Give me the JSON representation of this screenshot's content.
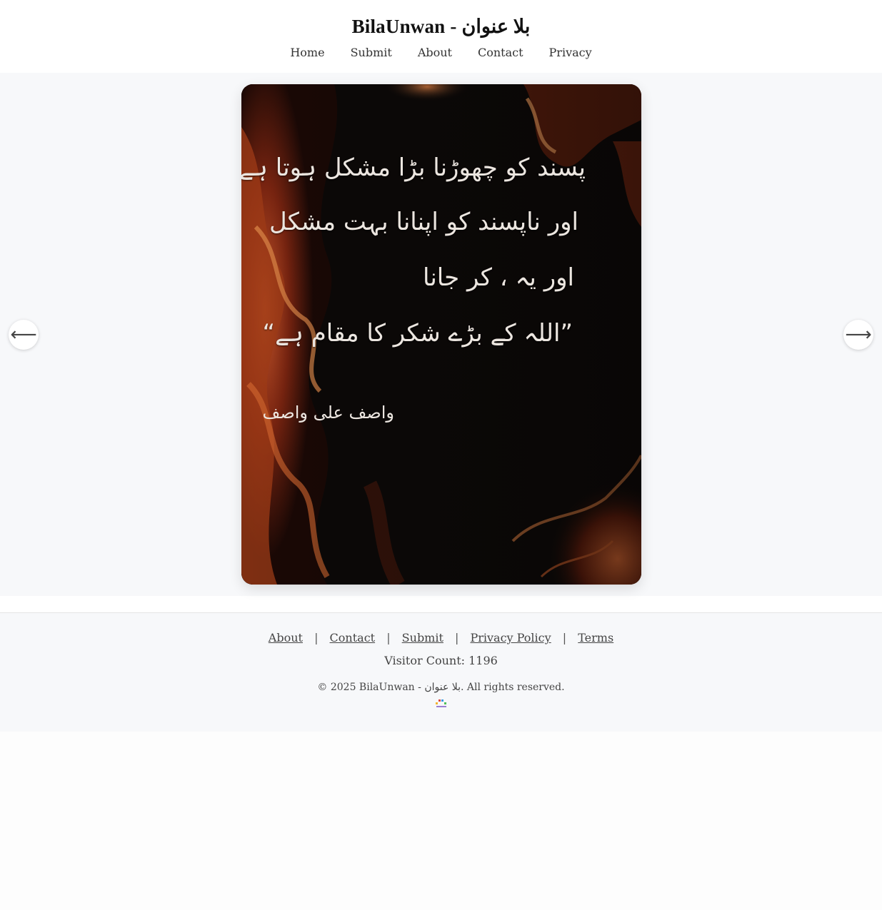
{
  "site": {
    "title": "BilaUnwan - بلا عنوان"
  },
  "nav": {
    "items": [
      {
        "label": "Home"
      },
      {
        "label": "Submit"
      },
      {
        "label": "About"
      },
      {
        "label": "Contact"
      },
      {
        "label": "Privacy"
      }
    ]
  },
  "post": {
    "lines": [
      "پسند کو چھوڑنا بڑا مشکل ہوتا ہے",
      "اور ناپسند کو اپنانا بہت مشکل",
      "اور یہ ، کر جانا",
      "”اللہ کے بڑے شکر کا مقام ہے“"
    ],
    "author": "واصف علی واصف"
  },
  "carousel": {
    "prev_icon": "arrow-left-icon",
    "next_icon": "arrow-right-icon",
    "prev_glyph": "⟵",
    "next_glyph": "⟶"
  },
  "footer": {
    "links": [
      {
        "label": "About"
      },
      {
        "label": "Contact"
      },
      {
        "label": "Submit"
      },
      {
        "label": "Privacy Policy"
      },
      {
        "label": "Terms"
      }
    ],
    "separator": "|",
    "visitor_count": "Visitor Count: 1196",
    "copyright": "© 2025 BilaUnwan - بلا عنوان. All rights reserved."
  },
  "colors": {
    "page_bg": "#f7f8fa",
    "card_bg": "#0b0807",
    "marble_orange": "#b8461c",
    "marble_dark": "#3a1209",
    "quote_text": "#ece6e0"
  }
}
